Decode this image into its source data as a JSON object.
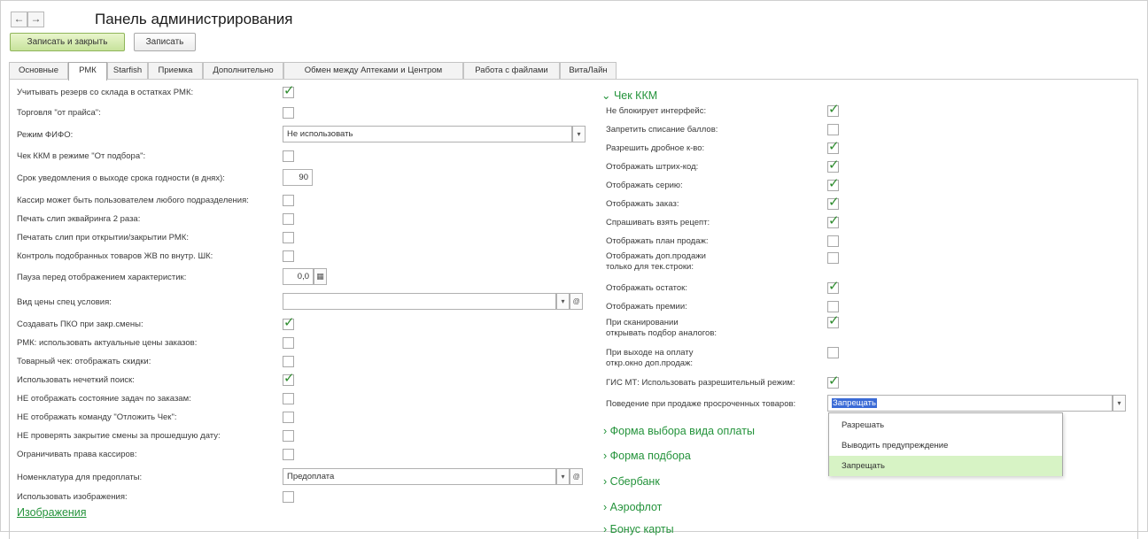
{
  "window": {
    "title": "Панель администрирования",
    "back_icon": "←",
    "forward_icon": "→"
  },
  "toolbar": {
    "save_close_label": "Записать и закрыть",
    "save_label": "Записать"
  },
  "tabs": [
    "Основные",
    "РМК",
    "Starfish",
    "Приемка",
    "Дополнительно",
    "Обмен между Аптеками и Центром",
    "Работа с файлами",
    "ВитаЛайн"
  ],
  "active_tab": "РМК",
  "check_symbol": "✓",
  "accent_color": "#24933b",
  "left": {
    "rows": [
      {
        "label": "Учитывать резерв со склада в остатках РМК:",
        "checked": true
      },
      {
        "label": "Торговля \"от прайса\":",
        "checked": false
      },
      {
        "label": "Режим ФИФО:",
        "value": "Не использовать"
      },
      {
        "label": "Чек ККМ в режиме \"От подбора\":",
        "checked": false
      },
      {
        "label": "Срок уведомления о выходе срока годности (в днях):",
        "value": "90"
      },
      {
        "label": "Кассир может быть пользователем любого подразделения:",
        "checked": false
      },
      {
        "label": "Печать слип эквайринга 2 раза:",
        "checked": false
      },
      {
        "label": "Печатать слип при открытии/закрытии РМК:",
        "checked": false
      },
      {
        "label": "Контроль подобранных товаров ЖВ по внутр. ШК:",
        "checked": false
      },
      {
        "label": "Пауза перед отображением характеристик:",
        "value": "0,0"
      },
      {
        "label": "Вид цены спец условия:",
        "value": ""
      },
      {
        "label": "Создавать ПКО при закр.смены:",
        "checked": true
      },
      {
        "label": "РМК: использовать актуальные цены заказов:",
        "checked": false
      },
      {
        "label": "Товарный чек: отображать скидки:",
        "checked": false
      },
      {
        "label": "Использовать нечеткий поиск:",
        "checked": true
      },
      {
        "label": "НЕ отображать состояние задач по заказам:",
        "checked": false
      },
      {
        "label": "НЕ отображать команду \"Отложить Чек\":",
        "checked": false
      },
      {
        "label": "НЕ проверять закрытие смены за прошедшую дату:",
        "checked": false
      },
      {
        "label": "Ограничивать права кассиров:",
        "checked": false
      },
      {
        "label": "Номенклатура для предоплаты:",
        "value": "Предоплата"
      },
      {
        "label": "Использовать изображения:",
        "checked": false
      }
    ],
    "images_link": "Изображения"
  },
  "right": {
    "section_title": "Чек ККМ",
    "rows": [
      {
        "label": "Не блокирует интерфейс:",
        "checked": true
      },
      {
        "label": "Запретить списание баллов:",
        "checked": false
      },
      {
        "label": "Разрешить дробное к-во:",
        "checked": true
      },
      {
        "label": "Отображать штрих-код:",
        "checked": true
      },
      {
        "label": "Отображать серию:",
        "checked": true
      },
      {
        "label": "Отображать заказ:",
        "checked": true
      },
      {
        "label": "Спрашивать взять рецепт:",
        "checked": true
      },
      {
        "label": "Отображать план продаж:",
        "checked": false
      },
      {
        "label": "Отображать доп.продажи",
        "label2": "только для тек.строки:",
        "checked": false
      },
      {
        "label": "Отображать остаток:",
        "checked": true
      },
      {
        "label": "Отображать премии:",
        "checked": false
      },
      {
        "label": "При сканировании",
        "label2": "открывать подбор аналогов:",
        "checked": true
      },
      {
        "label": "При выходе на оплату",
        "label2": "откр.окно доп.продаж:",
        "checked": false
      },
      {
        "label": "ГИС МТ: Использовать разрешительный режим:",
        "checked": true
      }
    ],
    "expired_label": "Поведение при продаже просроченных товаров:",
    "expired_value": "Запрещать",
    "expired_options": [
      "Разрешать",
      "Выводить предупреждение",
      "Запрещать"
    ],
    "sections": [
      "Форма выбора вида оплаты",
      "Форма подбора",
      "Сбербанк",
      "Аэрофлот",
      "Бонус карты"
    ]
  }
}
